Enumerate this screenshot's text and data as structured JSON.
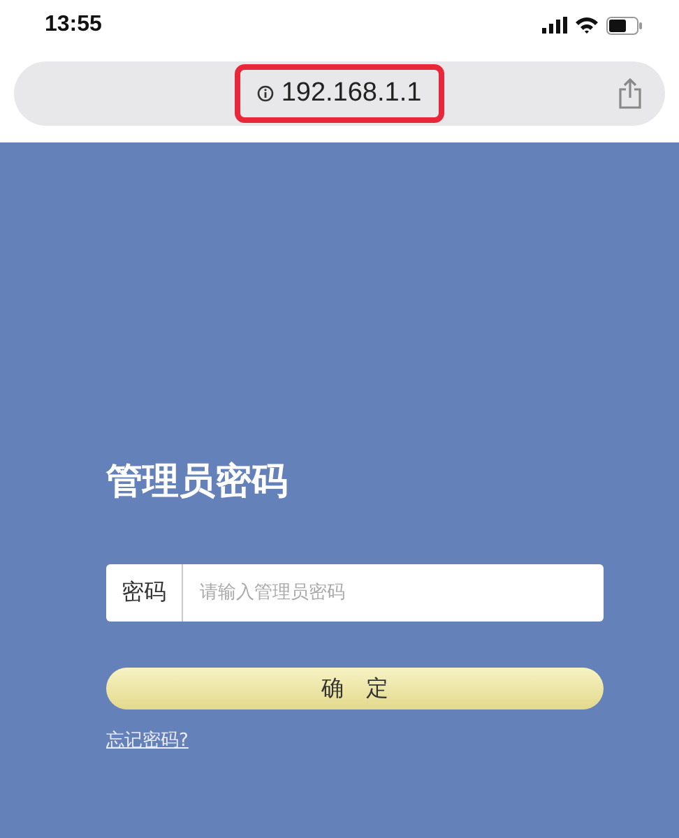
{
  "status_bar": {
    "time": "13:55"
  },
  "address_bar": {
    "url": "192.168.1.1",
    "highlighted": true
  },
  "login": {
    "title": "管理员密码",
    "field_label": "密码",
    "placeholder": "请输入管理员密码",
    "submit": "确　定",
    "forgot_link": "忘记密码?"
  }
}
